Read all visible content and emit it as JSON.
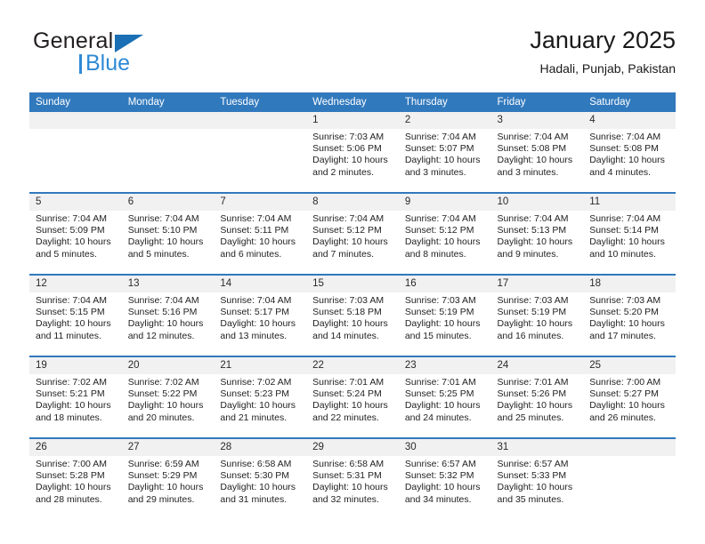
{
  "brand": {
    "name_top": "General",
    "name_bottom": "Blue",
    "accent_dark": "#1a6fb5",
    "accent_light": "#2e8ad6"
  },
  "header": {
    "title": "January 2025",
    "location": "Hadali, Punjab, Pakistan"
  },
  "theme": {
    "header_blue": "#3179bd",
    "daynum_band": "#f1f1f1",
    "text": "#1a1a1a"
  },
  "weekdays": [
    "Sunday",
    "Monday",
    "Tuesday",
    "Wednesday",
    "Thursday",
    "Friday",
    "Saturday"
  ],
  "labels": {
    "sunrise_prefix": "Sunrise: ",
    "sunset_prefix": "Sunset: ",
    "daylight_prefix": "Daylight: "
  },
  "weeks": [
    [
      {
        "day": "",
        "empty": true
      },
      {
        "day": "",
        "empty": true
      },
      {
        "day": "",
        "empty": true
      },
      {
        "day": "1",
        "sunrise": "Sunrise: 7:03 AM",
        "sunset": "Sunset: 5:06 PM",
        "daylight": "Daylight: 10 hours and 2 minutes."
      },
      {
        "day": "2",
        "sunrise": "Sunrise: 7:04 AM",
        "sunset": "Sunset: 5:07 PM",
        "daylight": "Daylight: 10 hours and 3 minutes."
      },
      {
        "day": "3",
        "sunrise": "Sunrise: 7:04 AM",
        "sunset": "Sunset: 5:08 PM",
        "daylight": "Daylight: 10 hours and 3 minutes."
      },
      {
        "day": "4",
        "sunrise": "Sunrise: 7:04 AM",
        "sunset": "Sunset: 5:08 PM",
        "daylight": "Daylight: 10 hours and 4 minutes."
      }
    ],
    [
      {
        "day": "5",
        "sunrise": "Sunrise: 7:04 AM",
        "sunset": "Sunset: 5:09 PM",
        "daylight": "Daylight: 10 hours and 5 minutes."
      },
      {
        "day": "6",
        "sunrise": "Sunrise: 7:04 AM",
        "sunset": "Sunset: 5:10 PM",
        "daylight": "Daylight: 10 hours and 5 minutes."
      },
      {
        "day": "7",
        "sunrise": "Sunrise: 7:04 AM",
        "sunset": "Sunset: 5:11 PM",
        "daylight": "Daylight: 10 hours and 6 minutes."
      },
      {
        "day": "8",
        "sunrise": "Sunrise: 7:04 AM",
        "sunset": "Sunset: 5:12 PM",
        "daylight": "Daylight: 10 hours and 7 minutes."
      },
      {
        "day": "9",
        "sunrise": "Sunrise: 7:04 AM",
        "sunset": "Sunset: 5:12 PM",
        "daylight": "Daylight: 10 hours and 8 minutes."
      },
      {
        "day": "10",
        "sunrise": "Sunrise: 7:04 AM",
        "sunset": "Sunset: 5:13 PM",
        "daylight": "Daylight: 10 hours and 9 minutes."
      },
      {
        "day": "11",
        "sunrise": "Sunrise: 7:04 AM",
        "sunset": "Sunset: 5:14 PM",
        "daylight": "Daylight: 10 hours and 10 minutes."
      }
    ],
    [
      {
        "day": "12",
        "sunrise": "Sunrise: 7:04 AM",
        "sunset": "Sunset: 5:15 PM",
        "daylight": "Daylight: 10 hours and 11 minutes."
      },
      {
        "day": "13",
        "sunrise": "Sunrise: 7:04 AM",
        "sunset": "Sunset: 5:16 PM",
        "daylight": "Daylight: 10 hours and 12 minutes."
      },
      {
        "day": "14",
        "sunrise": "Sunrise: 7:04 AM",
        "sunset": "Sunset: 5:17 PM",
        "daylight": "Daylight: 10 hours and 13 minutes."
      },
      {
        "day": "15",
        "sunrise": "Sunrise: 7:03 AM",
        "sunset": "Sunset: 5:18 PM",
        "daylight": "Daylight: 10 hours and 14 minutes."
      },
      {
        "day": "16",
        "sunrise": "Sunrise: 7:03 AM",
        "sunset": "Sunset: 5:19 PM",
        "daylight": "Daylight: 10 hours and 15 minutes."
      },
      {
        "day": "17",
        "sunrise": "Sunrise: 7:03 AM",
        "sunset": "Sunset: 5:19 PM",
        "daylight": "Daylight: 10 hours and 16 minutes."
      },
      {
        "day": "18",
        "sunrise": "Sunrise: 7:03 AM",
        "sunset": "Sunset: 5:20 PM",
        "daylight": "Daylight: 10 hours and 17 minutes."
      }
    ],
    [
      {
        "day": "19",
        "sunrise": "Sunrise: 7:02 AM",
        "sunset": "Sunset: 5:21 PM",
        "daylight": "Daylight: 10 hours and 18 minutes."
      },
      {
        "day": "20",
        "sunrise": "Sunrise: 7:02 AM",
        "sunset": "Sunset: 5:22 PM",
        "daylight": "Daylight: 10 hours and 20 minutes."
      },
      {
        "day": "21",
        "sunrise": "Sunrise: 7:02 AM",
        "sunset": "Sunset: 5:23 PM",
        "daylight": "Daylight: 10 hours and 21 minutes."
      },
      {
        "day": "22",
        "sunrise": "Sunrise: 7:01 AM",
        "sunset": "Sunset: 5:24 PM",
        "daylight": "Daylight: 10 hours and 22 minutes."
      },
      {
        "day": "23",
        "sunrise": "Sunrise: 7:01 AM",
        "sunset": "Sunset: 5:25 PM",
        "daylight": "Daylight: 10 hours and 24 minutes."
      },
      {
        "day": "24",
        "sunrise": "Sunrise: 7:01 AM",
        "sunset": "Sunset: 5:26 PM",
        "daylight": "Daylight: 10 hours and 25 minutes."
      },
      {
        "day": "25",
        "sunrise": "Sunrise: 7:00 AM",
        "sunset": "Sunset: 5:27 PM",
        "daylight": "Daylight: 10 hours and 26 minutes."
      }
    ],
    [
      {
        "day": "26",
        "sunrise": "Sunrise: 7:00 AM",
        "sunset": "Sunset: 5:28 PM",
        "daylight": "Daylight: 10 hours and 28 minutes."
      },
      {
        "day": "27",
        "sunrise": "Sunrise: 6:59 AM",
        "sunset": "Sunset: 5:29 PM",
        "daylight": "Daylight: 10 hours and 29 minutes."
      },
      {
        "day": "28",
        "sunrise": "Sunrise: 6:58 AM",
        "sunset": "Sunset: 5:30 PM",
        "daylight": "Daylight: 10 hours and 31 minutes."
      },
      {
        "day": "29",
        "sunrise": "Sunrise: 6:58 AM",
        "sunset": "Sunset: 5:31 PM",
        "daylight": "Daylight: 10 hours and 32 minutes."
      },
      {
        "day": "30",
        "sunrise": "Sunrise: 6:57 AM",
        "sunset": "Sunset: 5:32 PM",
        "daylight": "Daylight: 10 hours and 34 minutes."
      },
      {
        "day": "31",
        "sunrise": "Sunrise: 6:57 AM",
        "sunset": "Sunset: 5:33 PM",
        "daylight": "Daylight: 10 hours and 35 minutes."
      },
      {
        "day": "",
        "empty": true
      }
    ]
  ]
}
